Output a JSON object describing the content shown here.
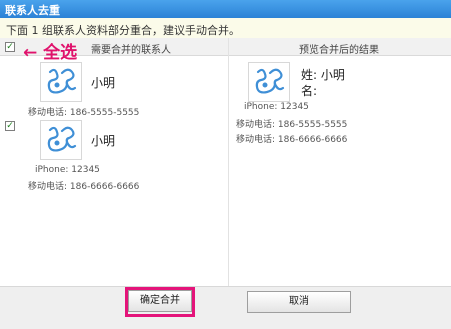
{
  "window": {
    "title": "联系人去重"
  },
  "notice": {
    "text": "下面 1 组联系人资料部分重合，建议手动合并。"
  },
  "columns": {
    "left": "需要合并的联系人",
    "right": "预览合并后的结果"
  },
  "annotation": {
    "arrow_label": "← 全选"
  },
  "left_contacts": [
    {
      "name": "小明",
      "fields": [
        "移动电话: 186-5555-5555"
      ]
    },
    {
      "name": "小明",
      "fields": [
        "iPhone: 12345",
        "移动电话: 186-6666-6666"
      ]
    }
  ],
  "preview": {
    "last_name_label": "姓: 小明",
    "first_name_label": "名:",
    "fields": [
      "iPhone: 12345",
      "移动电话: 186-5555-5555",
      "移动电话: 186-6666-6666"
    ]
  },
  "buttons": {
    "confirm": "确定合并",
    "cancel": "取消"
  },
  "colors": {
    "highlight": "#e4147a",
    "titlebar": "#2b82d6",
    "avatar_icon": "#3f8fd6"
  }
}
